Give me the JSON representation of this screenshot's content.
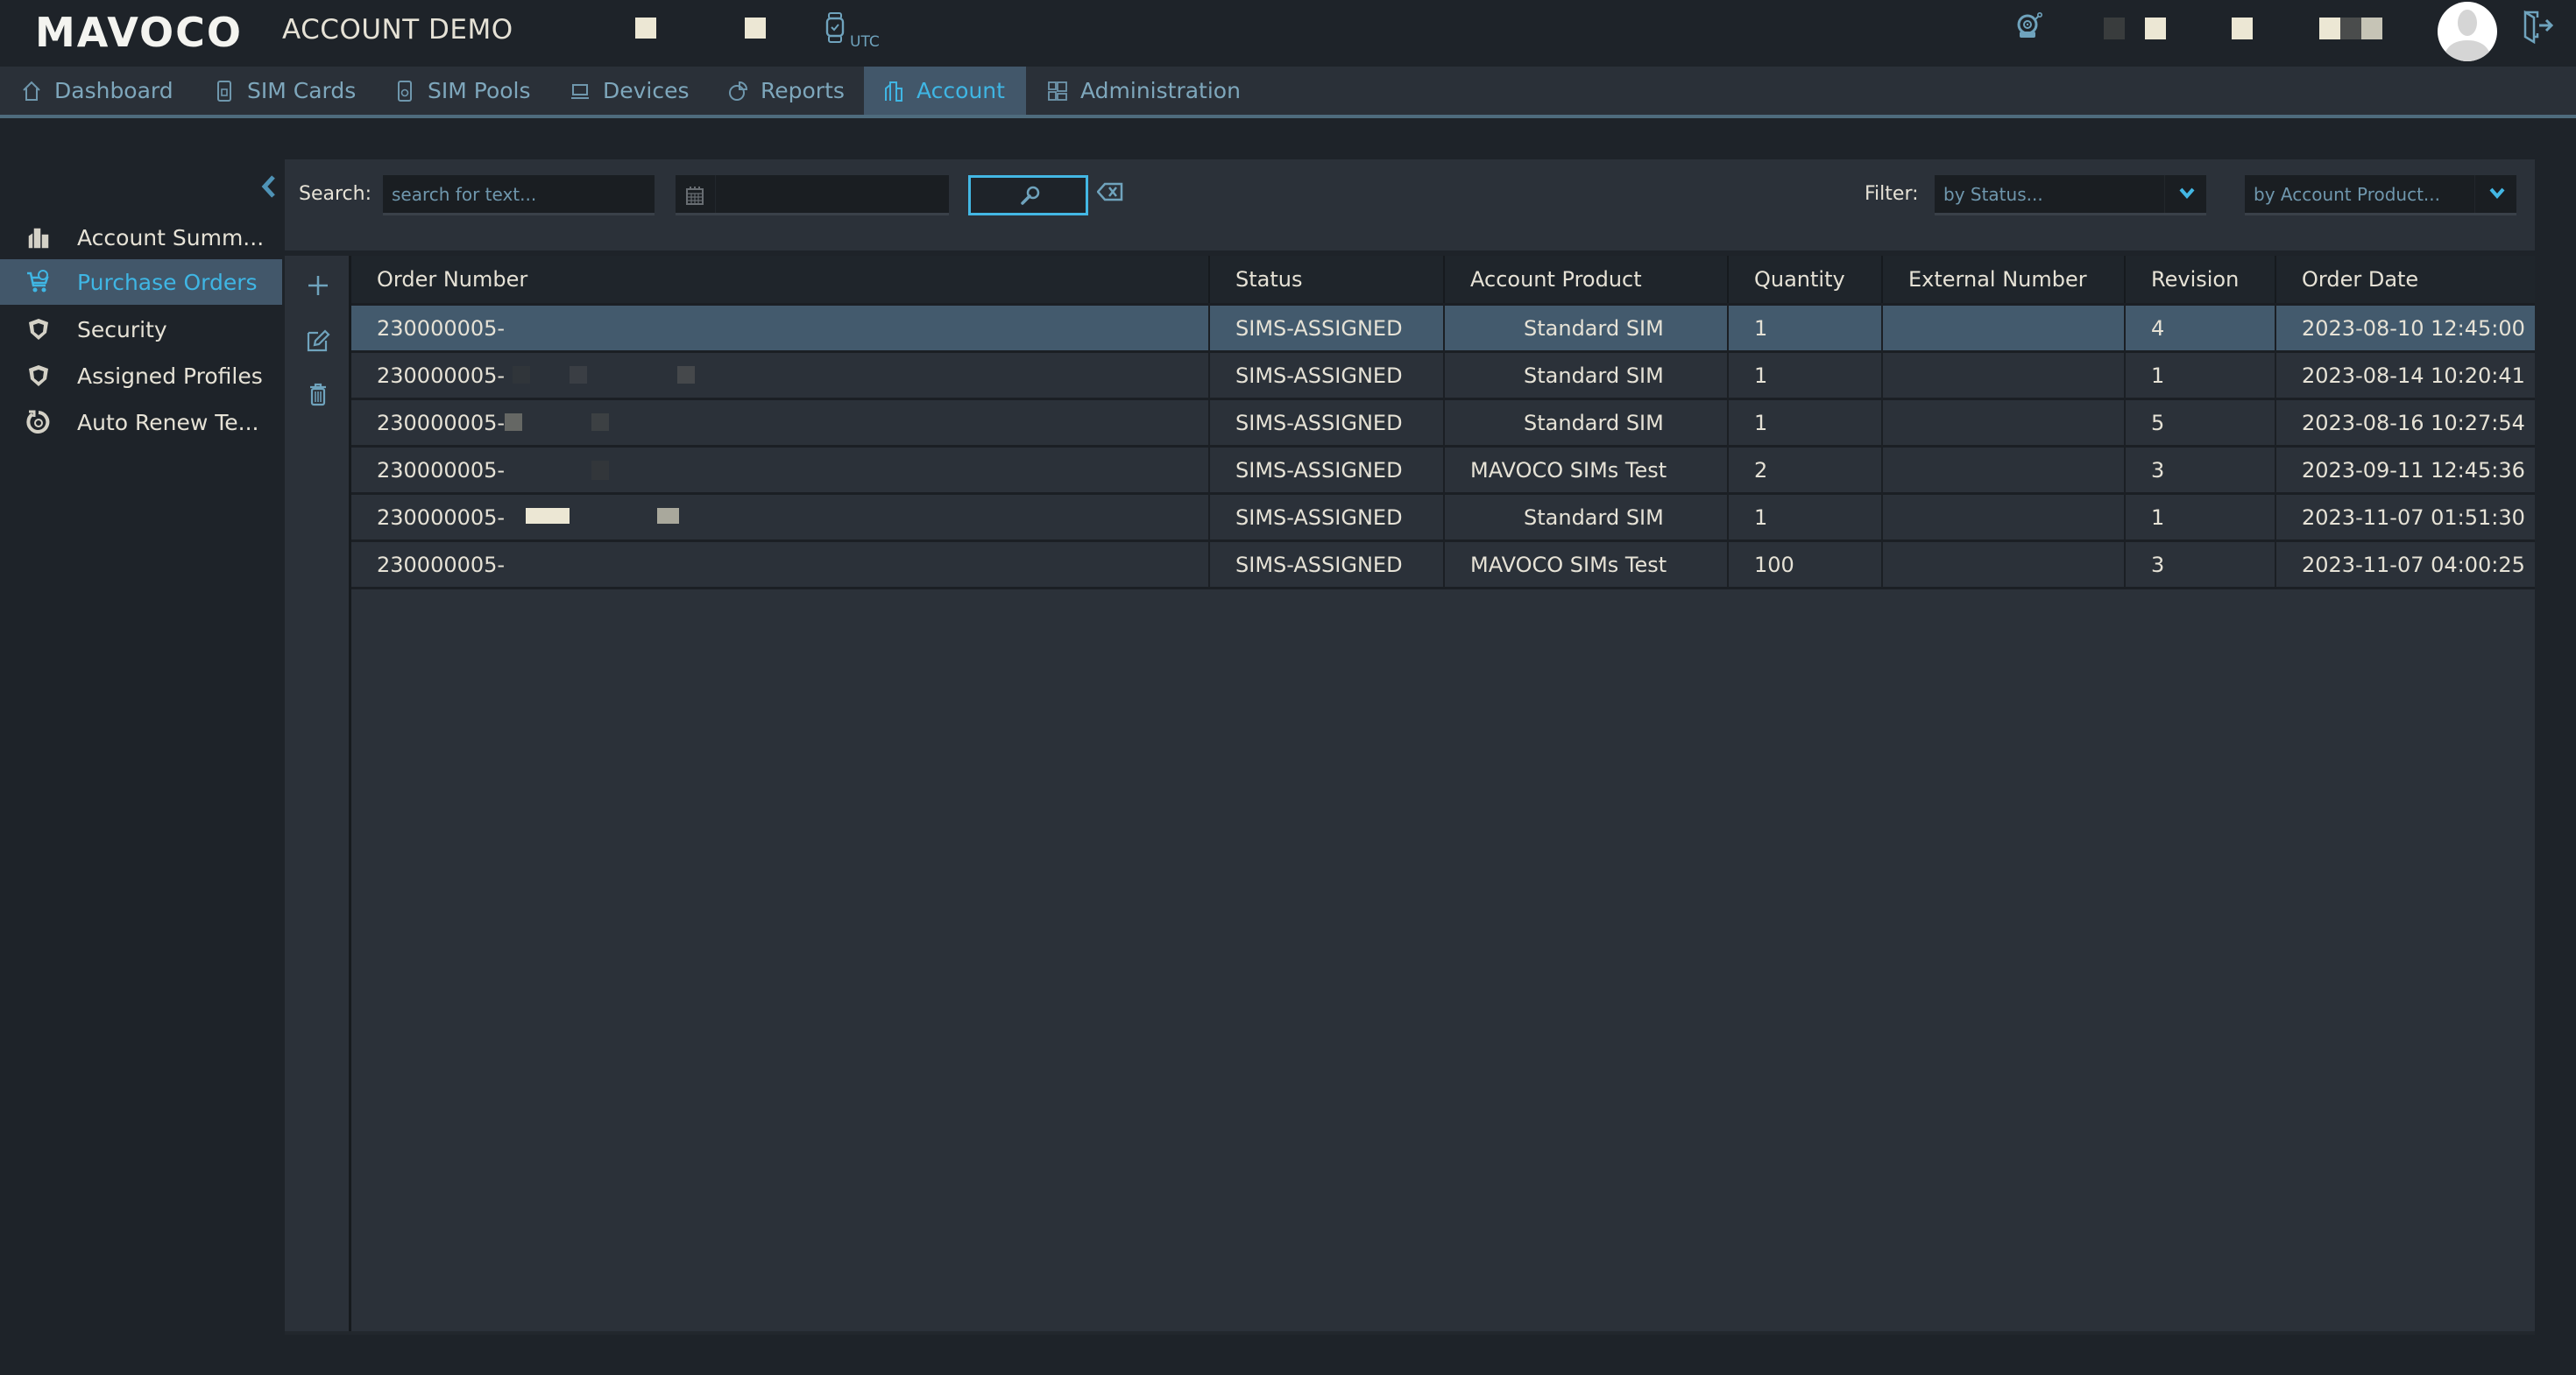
{
  "header": {
    "logo": "MAVOCO",
    "title": "ACCOUNT DEMO",
    "timezone_label": "UTC",
    "icons": {
      "timezone": "smartwatch-icon",
      "alarm": "alarm-bell-icon",
      "avatar": "user-avatar",
      "logout": "logout-icon"
    }
  },
  "nav": {
    "tabs": [
      {
        "label": "Dashboard",
        "icon": "home-icon",
        "active": false
      },
      {
        "label": "SIM Cards",
        "icon": "sim-card-icon",
        "active": false
      },
      {
        "label": "SIM Pools",
        "icon": "sim-pool-icon",
        "active": false
      },
      {
        "label": "Devices",
        "icon": "laptop-icon",
        "active": false
      },
      {
        "label": "Reports",
        "icon": "pie-chart-icon",
        "active": false
      },
      {
        "label": "Account",
        "icon": "buildings-icon",
        "active": true
      },
      {
        "label": "Administration",
        "icon": "admin-grid-icon",
        "active": false
      }
    ]
  },
  "sidebar": {
    "collapse_icon": "chevron-left-icon",
    "items": [
      {
        "label": "Account Summ...",
        "icon": "buildings-icon",
        "active": false
      },
      {
        "label": "Purchase Orders",
        "icon": "cart-download-icon",
        "active": true
      },
      {
        "label": "Security",
        "icon": "shield-icon",
        "active": false
      },
      {
        "label": "Assigned Profiles",
        "icon": "shield-icon",
        "active": false
      },
      {
        "label": "Auto Renew Te...",
        "icon": "renew-icon",
        "active": false
      }
    ]
  },
  "search": {
    "label": "Search:",
    "text_placeholder": "search for text...",
    "text_value": "",
    "date_value": "",
    "filter_label": "Filter:",
    "status_filter": "by Status...",
    "product_filter": "by Account Product..."
  },
  "actions": {
    "add": "plus-icon",
    "edit": "edit-icon",
    "delete": "trash-icon"
  },
  "table": {
    "columns": [
      "Order Number",
      "Status",
      "Account Product",
      "Quantity",
      "External Number",
      "Revision",
      "Order Date"
    ],
    "rows": [
      {
        "order_number": "230000005-",
        "status": "SIMS-ASSIGNED",
        "product": "Standard SIM",
        "quantity": "1",
        "external_number": "",
        "revision": "4",
        "order_date": "2023-08-10 12:45:00",
        "selected": true
      },
      {
        "order_number": "230000005-",
        "status": "SIMS-ASSIGNED",
        "product": "Standard SIM",
        "quantity": "1",
        "external_number": "",
        "revision": "1",
        "order_date": "2023-08-14 10:20:41",
        "selected": false
      },
      {
        "order_number": "230000005-",
        "status": "SIMS-ASSIGNED",
        "product": "Standard SIM",
        "quantity": "1",
        "external_number": "",
        "revision": "5",
        "order_date": "2023-08-16 10:27:54",
        "selected": false
      },
      {
        "order_number": "230000005-",
        "status": "SIMS-ASSIGNED",
        "product": "MAVOCO SIMs Test",
        "quantity": "2",
        "external_number": "",
        "revision": "3",
        "order_date": "2023-09-11 12:45:36",
        "selected": false
      },
      {
        "order_number": "230000005-",
        "status": "SIMS-ASSIGNED",
        "product": "Standard SIM",
        "quantity": "1",
        "external_number": "",
        "revision": "1",
        "order_date": "2023-11-07 01:51:30",
        "selected": false
      },
      {
        "order_number": "230000005-",
        "status": "SIMS-ASSIGNED",
        "product": "MAVOCO SIMs Test",
        "quantity": "100",
        "external_number": "",
        "revision": "3",
        "order_date": "2023-11-07 04:00:25",
        "selected": false
      }
    ]
  },
  "colors": {
    "accent": "#3fb6e4",
    "icon_blue": "#6fa3bd",
    "header_bg": "#1e2329",
    "panel_bg": "#2b3139",
    "selected_bg": "#435a6d",
    "text": "#e6e2d6"
  }
}
